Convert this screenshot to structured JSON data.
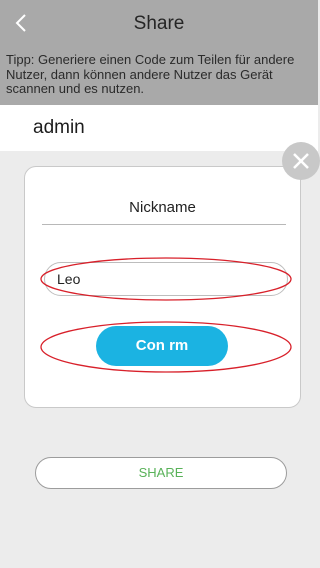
{
  "header": {
    "title": "Share",
    "back_icon": "chevron-left-icon"
  },
  "tip": {
    "text": "Tipp: Generiere einen Code zum Teilen für andere Nutzer, dann können andere Nutzer das Gerät scannen und es nutzen."
  },
  "account": {
    "username": "admin"
  },
  "dialog": {
    "close_icon": "close-icon",
    "nickname_label": "Nickname",
    "nickname_value": "Leo",
    "confirm_label": "Con rm"
  },
  "share_button": {
    "label": "SHARE"
  },
  "colors": {
    "header_bg": "#a9a9a9",
    "page_bg": "#ececec",
    "confirm_bg": "#1bb3e2",
    "share_text": "#59b259",
    "annotation": "#d8202a"
  }
}
